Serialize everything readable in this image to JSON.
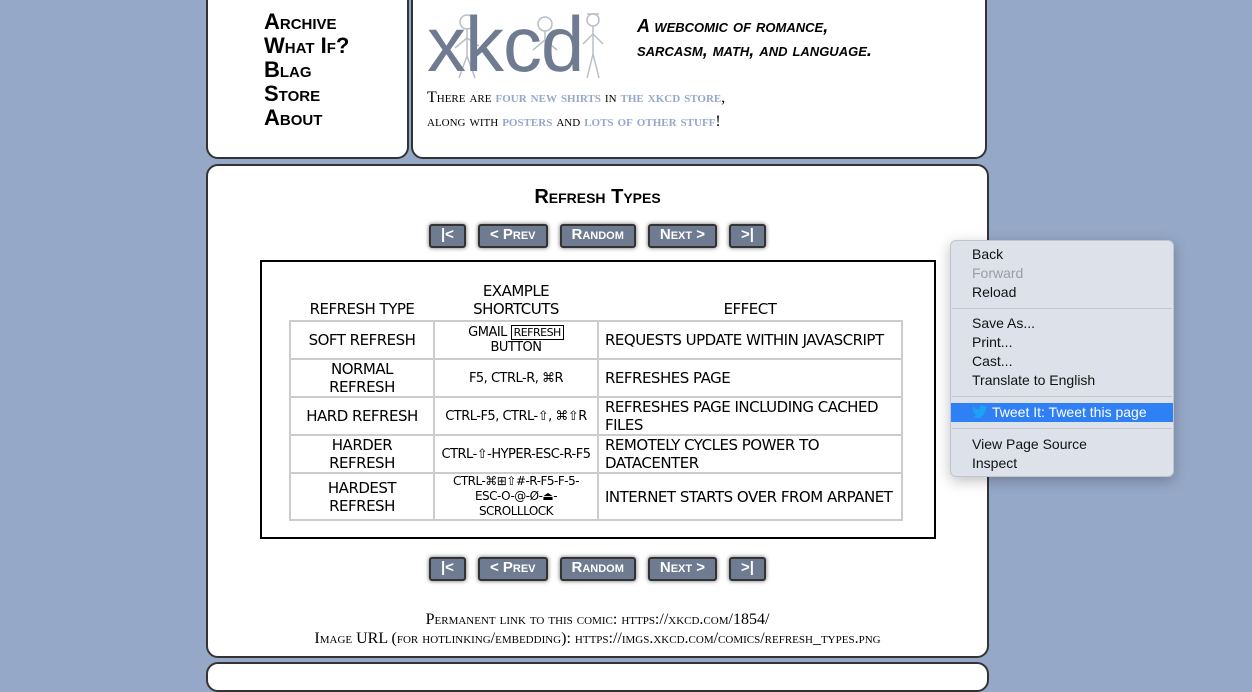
{
  "nav": {
    "links": [
      "Archive",
      "What If?",
      "Blag",
      "Store",
      "About"
    ]
  },
  "header": {
    "logo_text": "xkcd",
    "slogan_line1": "A webcomic of romance,",
    "slogan_line2": "sarcasm, math, and language.",
    "news": {
      "t1": "There are ",
      "link1": "four new shirts",
      "t2": " in ",
      "link2": "the xkcd store",
      "t3": ",",
      "t4": "along with ",
      "link3": "posters",
      "t5": " and ",
      "link4": "lots of other stuff",
      "t6": "!"
    }
  },
  "comic": {
    "title": "Refresh Types",
    "nav_buttons": [
      "|<",
      "< Prev",
      "Random",
      "Next >",
      ">|"
    ],
    "table": {
      "headers": [
        "REFRESH TYPE",
        "EXAMPLE SHORTCUTS",
        "EFFECT"
      ],
      "rows": [
        {
          "type": "SOFT REFRESH",
          "shortcut_pre": "GMAIL ",
          "shortcut_key": "REFRESH",
          "shortcut_post": " BUTTON",
          "effect": "REQUESTS UPDATE WITHIN JAVASCRIPT"
        },
        {
          "type": "NORMAL REFRESH",
          "shortcut": "F5, CTRL-R, ⌘R",
          "effect": "REFRESHES PAGE"
        },
        {
          "type": "HARD REFRESH",
          "shortcut": "CTRL-F5, CTRL-⇧, ⌘⇧R",
          "effect": "REFRESHES PAGE INCLUDING CACHED FILES"
        },
        {
          "type": "HARDER REFRESH",
          "shortcut": "CTRL-⇧-HYPER-ESC-R-F5",
          "effect": "REMOTELY CYCLES POWER TO DATACENTER"
        },
        {
          "type": "HARDEST REFRESH",
          "shortcut_line1": "CTRL-⌘⊞⇧#-R-F5-F-5-",
          "shortcut_line2": "ESC-O-@-Ø-⏏-SCROLLLOCK",
          "effect": "INTERNET STARTS OVER FROM ARPANET"
        }
      ]
    },
    "permalink_label": "Permanent link to this comic: ",
    "permalink_url": "https://xkcd.com/1854/",
    "image_url_label": "Image URL (for hotlinking/embedding): ",
    "image_url": "https://imgs.xkcd.com/comics/refresh_types.png"
  },
  "context_menu": {
    "items": {
      "back": "Back",
      "forward": "Forward",
      "reload": "Reload",
      "save_as": "Save As...",
      "print": "Print...",
      "cast": "Cast...",
      "translate": "Translate to English",
      "tweet": "Tweet It: Tweet this page",
      "view_source": "View Page Source",
      "inspect": "Inspect"
    },
    "highlight_color": "#2f7ff5",
    "twitter_icon": "twitter-bird-icon"
  },
  "colors": {
    "page_bg": "#96a8c8",
    "button_bg": "#6e7b91"
  }
}
